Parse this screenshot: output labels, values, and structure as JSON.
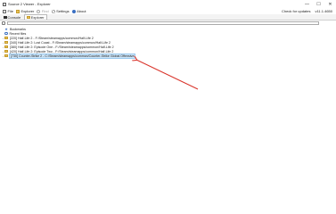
{
  "window": {
    "title": "Source 2 Viewer - Explorer",
    "controls": [
      "—",
      "☐",
      "✕"
    ]
  },
  "menu": {
    "items": [
      {
        "label": "File",
        "icon": "file-icon"
      },
      {
        "label": "Explorer",
        "icon": "explorer-icon"
      },
      {
        "label": "Find",
        "icon": "find-icon",
        "disabled": true
      },
      {
        "label": "Settings",
        "icon": "settings-icon"
      },
      {
        "label": "About",
        "icon": "about-icon"
      }
    ],
    "check_updates": "Check for updates",
    "version": "v11.1.4650"
  },
  "tabs": [
    {
      "label": "Console",
      "icon": "console-icon"
    },
    {
      "label": "Explorer",
      "icon": "explorer-icon",
      "active": true
    }
  ],
  "tree": {
    "items": [
      {
        "label": "Bookmarks",
        "icon": "star-icon",
        "type": "special"
      },
      {
        "label": "Recent files",
        "icon": "clock-icon",
        "type": "special"
      },
      {
        "label": "[220] Half-Life 2 - F:/Steam/steamapps/common/Half-Life 2",
        "icon": "folder-icon",
        "type": "folder"
      },
      {
        "label": "[340] Half-Life 2: Lost Coast - F:/Steam/steamapps/common/Half-Life 2",
        "icon": "folder-icon",
        "type": "folder"
      },
      {
        "label": "[380] Half-Life 2: Episode One - F:/Steam/steamapps/common/Half-Life 2",
        "icon": "folder-icon",
        "type": "folder"
      },
      {
        "label": "[420] Half-Life 2: Episode Two - F:/Steam/steamapps/common/Half-Life 2",
        "icon": "folder-icon",
        "type": "folder"
      },
      {
        "label": "[730] Counter-Strike 2 - C:/Steam/steamapps/common/Counter-Strike Global Offensive",
        "icon": "folder-icon",
        "type": "folder",
        "selected": true
      }
    ]
  },
  "annotation": {
    "color": "#d9342b"
  }
}
